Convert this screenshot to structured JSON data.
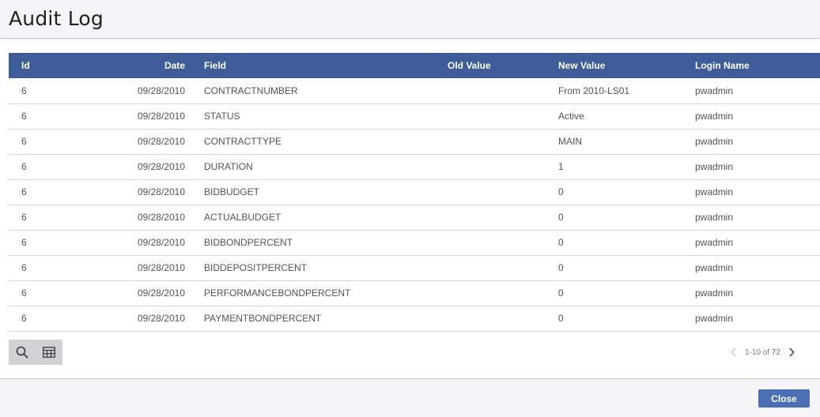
{
  "header": {
    "title": "Audit Log"
  },
  "table": {
    "columns": {
      "id": "Id",
      "date": "Date",
      "field": "Field",
      "old_value": "Old Value",
      "new_value": "New Value",
      "login_name": "Login Name"
    },
    "rows": [
      {
        "id": "6",
        "date": "09/28/2010",
        "field": "CONTRACTNUMBER",
        "old_value": "",
        "new_value": "From 2010-LS01",
        "login_name": "pwadmin"
      },
      {
        "id": "6",
        "date": "09/28/2010",
        "field": "STATUS",
        "old_value": "",
        "new_value": "Active",
        "login_name": "pwadmin"
      },
      {
        "id": "6",
        "date": "09/28/2010",
        "field": "CONTRACTTYPE",
        "old_value": "",
        "new_value": "MAIN",
        "login_name": "pwadmin"
      },
      {
        "id": "6",
        "date": "09/28/2010",
        "field": "DURATION",
        "old_value": "",
        "new_value": "1",
        "login_name": "pwadmin"
      },
      {
        "id": "6",
        "date": "09/28/2010",
        "field": "BIDBUDGET",
        "old_value": "",
        "new_value": "0",
        "login_name": "pwadmin"
      },
      {
        "id": "6",
        "date": "09/28/2010",
        "field": "ACTUALBUDGET",
        "old_value": "",
        "new_value": "0",
        "login_name": "pwadmin"
      },
      {
        "id": "6",
        "date": "09/28/2010",
        "field": "BIDBONDPERCENT",
        "old_value": "",
        "new_value": "0",
        "login_name": "pwadmin"
      },
      {
        "id": "6",
        "date": "09/28/2010",
        "field": "BIDDEPOSITPERCENT",
        "old_value": "",
        "new_value": "0",
        "login_name": "pwadmin"
      },
      {
        "id": "6",
        "date": "09/28/2010",
        "field": "PERFORMANCEBONDPERCENT",
        "old_value": "",
        "new_value": "0",
        "login_name": "pwadmin"
      },
      {
        "id": "6",
        "date": "09/28/2010",
        "field": "PAYMENTBONDPERCENT",
        "old_value": "",
        "new_value": "0",
        "login_name": "pwadmin"
      }
    ]
  },
  "toolbar": {
    "icons": [
      "search-icon",
      "grid-columns-icon"
    ]
  },
  "pager": {
    "text": "1-10 of 72",
    "prev_icon": "chevron-left-icon",
    "next_icon": "chevron-right-icon"
  },
  "footer": {
    "close_label": "Close"
  },
  "colors": {
    "header_bg": "#3d5c99",
    "button_bg": "#4a6fb5"
  }
}
